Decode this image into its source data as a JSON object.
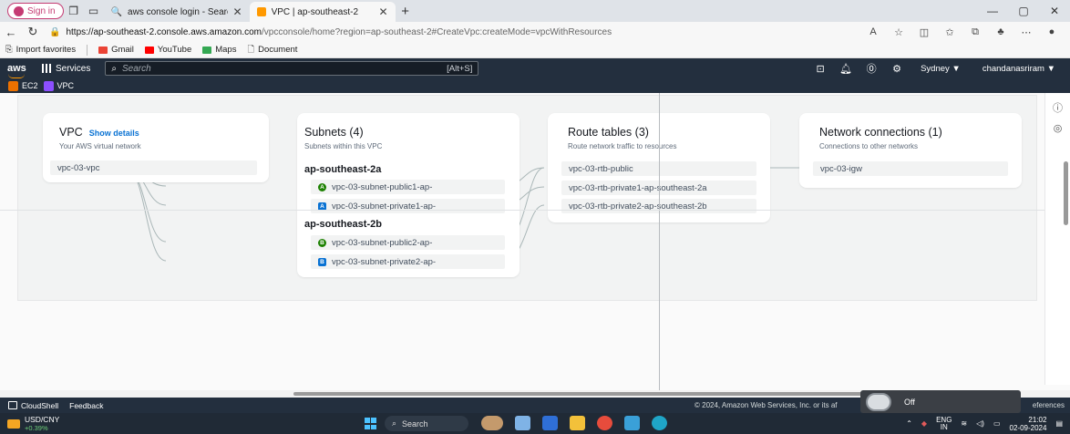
{
  "browser": {
    "signin_label": "Sign in",
    "tabs": [
      {
        "title": "aws console login - Search"
      },
      {
        "title": "VPC | ap-southeast-2"
      }
    ],
    "url_host": "https://ap-southeast-2.console.aws.amazon.com",
    "url_path": "/vpcconsole/home?region=ap-southeast-2#CreateVpc:createMode=vpcWithResources",
    "favorites": [
      "Import favorites",
      "Gmail",
      "YouTube",
      "Maps",
      "Document"
    ]
  },
  "aws_nav": {
    "logo": "aws",
    "services_label": "Services",
    "search_placeholder": "Search",
    "search_hint": "[Alt+S]",
    "region": "Sydney ▼",
    "account": "chandanasriram ▼",
    "service_shortcuts": [
      "EC2",
      "VPC"
    ]
  },
  "cards": {
    "vpc": {
      "title": "VPC",
      "link": "Show details",
      "subtitle": "Your AWS virtual network",
      "items": [
        "vpc-03-vpc"
      ]
    },
    "subnets": {
      "title": "Subnets (4)",
      "subtitle": "Subnets within this VPC",
      "zones": [
        {
          "name": "ap-southeast-2a",
          "items": [
            {
              "label": "vpc-03-subnet-public1-ap-",
              "badge": "A",
              "kind": "public"
            },
            {
              "label": "vpc-03-subnet-private1-ap-",
              "badge": "A",
              "kind": "private"
            }
          ]
        },
        {
          "name": "ap-southeast-2b",
          "items": [
            {
              "label": "vpc-03-subnet-public2-ap-",
              "badge": "B",
              "kind": "public"
            },
            {
              "label": "vpc-03-subnet-private2-ap-",
              "badge": "B",
              "kind": "private"
            }
          ]
        }
      ]
    },
    "route_tables": {
      "title": "Route tables (3)",
      "subtitle": "Route network traffic to resources",
      "items": [
        "vpc-03-rtb-public",
        "vpc-03-rtb-private1-ap-southeast-2a",
        "vpc-03-rtb-private2-ap-southeast-2b"
      ]
    },
    "network": {
      "title": "Network connections (1)",
      "subtitle": "Connections to other networks",
      "items": [
        "vpc-03-igw"
      ]
    }
  },
  "footer": {
    "cloudshell": "CloudShell",
    "feedback": "Feedback",
    "copyright": "© 2024, Amazon Web Services, Inc. or its af",
    "preferences": "eferences",
    "toggle_label": "Off"
  },
  "taskbar": {
    "ticker_name": "USD/CNY",
    "ticker_change": "+0.39%",
    "search_placeholder": "Search",
    "lang_top": "ENG",
    "lang_bottom": "IN",
    "time": "21:02",
    "date": "02-09-2024"
  },
  "colors": {
    "aws_nav": "#232f3e",
    "aws_orange": "#ff9900",
    "link_blue": "#0972d3",
    "public_green": "#1d8102"
  }
}
